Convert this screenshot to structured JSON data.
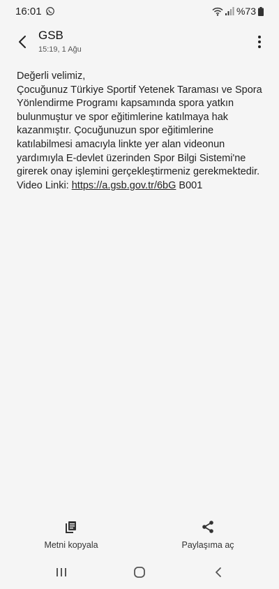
{
  "status": {
    "time": "16:01",
    "battery": "%73",
    "icons": [
      "whatsapp-icon",
      "wifi-icon",
      "signal-icon",
      "battery-icon"
    ]
  },
  "header": {
    "sender": "GSB",
    "date": "15:19, 1 Ağu",
    "icons": [
      "back-arrow-icon",
      "more-vertical-icon"
    ]
  },
  "message": {
    "body": "Değerli velimiz,\nÇocuğunuz Türkiye Sportif Yetenek Taraması ve Spora Yönlendirme Programı kapsamında spora yatkın bulunmuştur ve spor eğitimlerine katılmaya hak kazanmıştır. Çocuğunuzun spor eğitimlerine katılabilmesi amacıyla linkte yer alan videonun yardımıyla E-devlet üzerinden Spor Bilgi Sistemi'ne girerek onay işlemini gerçekleştirmeniz gerekmektedir.",
    "video_prefix": "Video Linki: ",
    "video_link": "https://a.gsb.gov.tr/6bG",
    "video_suffix": " B001"
  },
  "actions": {
    "copy_label": "Metni kopyala",
    "share_label": "Paylaşıma aç"
  },
  "nav": {
    "icons": [
      "recents-icon",
      "home-icon",
      "back-icon"
    ]
  },
  "colors": {
    "background": "#f5f5f5",
    "text": "#222222"
  }
}
